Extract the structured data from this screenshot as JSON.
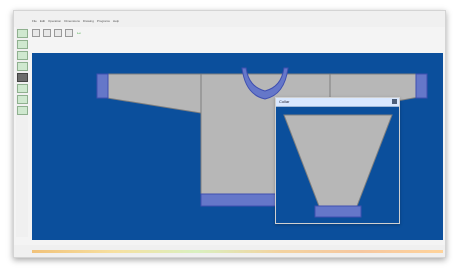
{
  "app": {
    "menu_items": [
      "File",
      "Edit",
      "Operation",
      "Dimensions",
      "Drawing",
      "Programs",
      "Help"
    ]
  },
  "popup": {
    "title": "Collar"
  },
  "colors": {
    "canvas_bg": "#0b4f9c",
    "garment_fill": "#b7b7b7",
    "rib_fill": "#6577c9",
    "rib_stroke": "#3f4fb0"
  }
}
